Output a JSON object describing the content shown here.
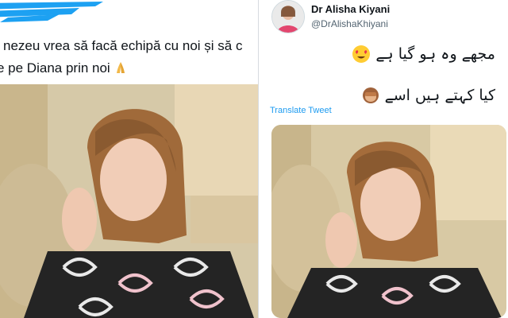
{
  "left_tweet": {
    "line1": "nezeu vrea să facă echipă cu noi și să c",
    "line2": "e pe Diana prin noi"
  },
  "right_tweet": {
    "author_name": "Dr Alisha Kiyani",
    "author_handle": "@DrAlishaKhiyani",
    "line1": "مجھے وہ ہو گیا ہے",
    "line2": "کیا کہتے ہیں اسے",
    "translate_label": "Translate Tweet"
  },
  "colors": {
    "link_blue": "#1d9bf0",
    "scribble_blue": "#1da1f2"
  },
  "icons": [
    "praying-hands-emoji",
    "heart-eyes-emoji",
    "see-no-evil-monkey-emoji",
    "verified-avatar"
  ]
}
